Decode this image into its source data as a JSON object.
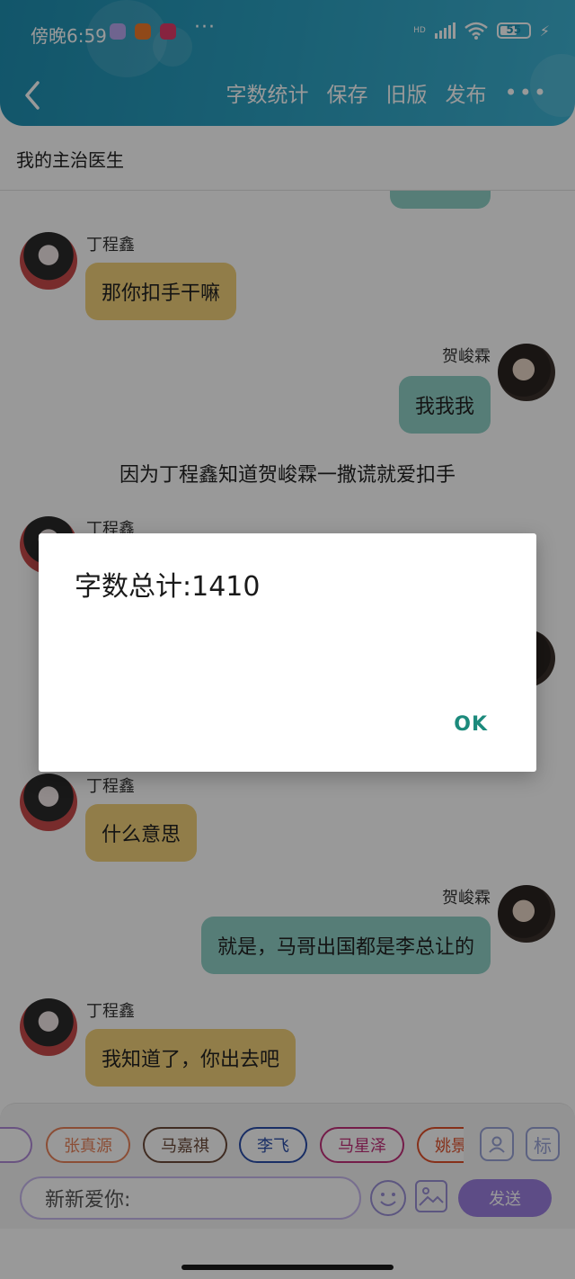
{
  "status_bar": {
    "time": "傍晚6:59",
    "more": "···",
    "network": "HD",
    "battery": "55",
    "app_colors": [
      "#b9a7ef",
      "#f07a2a",
      "#e23b6a"
    ]
  },
  "header": {
    "actions": [
      "字数统计",
      "保存",
      "旧版",
      "发布"
    ],
    "more": "•••"
  },
  "chat_title": "我的主治医生",
  "messages": {
    "m1": {
      "sender": "丁程鑫",
      "text": "那你扣手干嘛"
    },
    "m2": {
      "sender": "贺峻霖",
      "text": "我我我"
    },
    "narration": "因为丁程鑫知道贺峻霖一撒谎就爱扣手",
    "m3": {
      "sender": "丁程鑫"
    },
    "m4": {
      "sender": "丁程鑫",
      "text": "什么意思"
    },
    "m5": {
      "sender": "贺峻霖",
      "text": "就是，马哥出国都是李总让的"
    },
    "m6": {
      "sender": "丁程鑫",
      "text": "我知道了，你出去吧"
    }
  },
  "character_chips": [
    {
      "label": "张真源",
      "color": "#e8825a"
    },
    {
      "label": "马嘉祺",
      "color": "#6b4a3a"
    },
    {
      "label": "李飞",
      "color": "#2a4ea8"
    },
    {
      "label": "马星泽",
      "color": "#c2307a"
    },
    {
      "label": "姚景",
      "color": "#e0502a"
    }
  ],
  "tool_buttons": {
    "tag_label": "标"
  },
  "input": {
    "value": "新新爱你:"
  },
  "send_label": "发送",
  "dialog": {
    "title": "字数总计:1410",
    "ok_label": "OK"
  }
}
